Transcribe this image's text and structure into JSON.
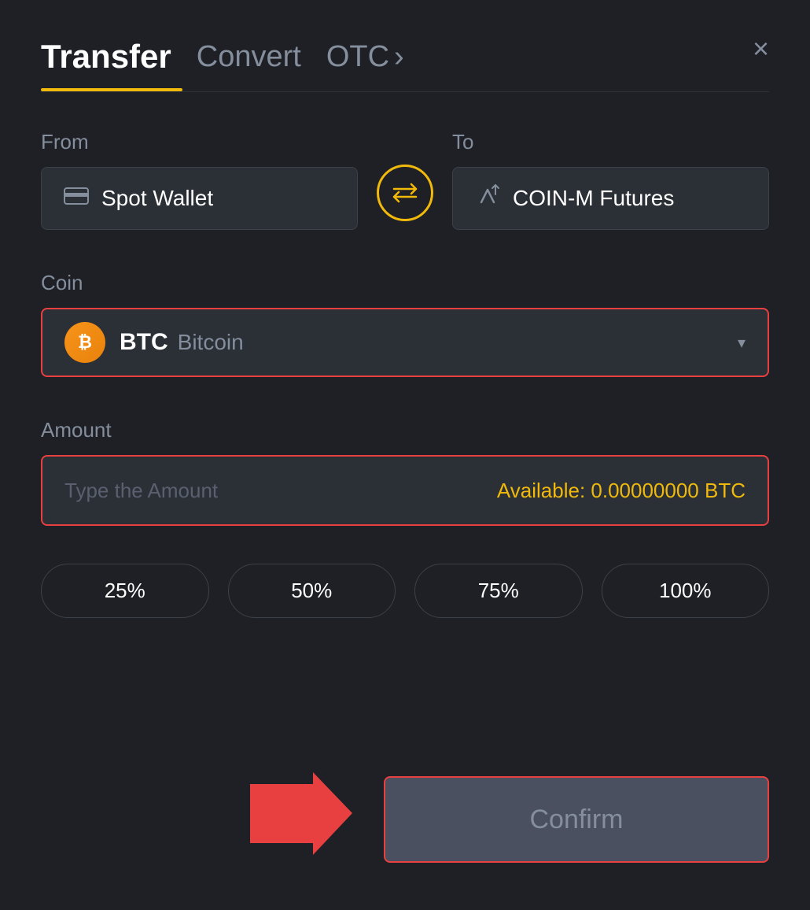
{
  "header": {
    "tab_transfer": "Transfer",
    "tab_convert": "Convert",
    "tab_otc": "OTC",
    "tab_otc_arrow": "›",
    "close_label": "×"
  },
  "from_section": {
    "label": "From",
    "wallet_name": "Spot Wallet"
  },
  "to_section": {
    "label": "To",
    "wallet_name": "COIN-M Futures"
  },
  "coin_section": {
    "label": "Coin",
    "coin_symbol": "BTC",
    "coin_name": "Bitcoin",
    "coin_icon": "₿"
  },
  "amount_section": {
    "label": "Amount",
    "placeholder": "Type the Amount",
    "available_label": "Available:",
    "available_value": "0.00000000 BTC"
  },
  "percent_buttons": [
    "25%",
    "50%",
    "75%",
    "100%"
  ],
  "confirm_button": {
    "label": "Confirm"
  },
  "icons": {
    "wallet_icon": "🪙",
    "futures_icon": "↑",
    "swap_icon": "⇄",
    "chevron": "▾"
  }
}
